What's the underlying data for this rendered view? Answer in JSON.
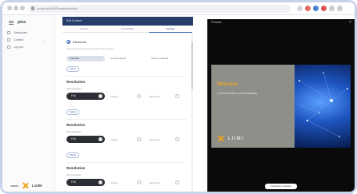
{
  "browser": {
    "url": "localhost:8080/content/editor"
  },
  "sidebar": {
    "brand": "pico",
    "items": [
      {
        "label": "Dashboard"
      },
      {
        "label": "Content"
      },
      {
        "label": "Log out"
      }
    ],
    "footer_word": "LUMI"
  },
  "editor": {
    "header": "Edit Content",
    "tabs": [
      {
        "label": "Content"
      },
      {
        "label": "Accessibility"
      },
      {
        "label": "Settings"
      }
    ],
    "first_option": {
      "label": "Elements",
      "hint": "Choose how elements appear in the content",
      "chips": [
        "Standard",
        "Content layout",
        "Source material"
      ]
    },
    "button_label": "Delete",
    "resolutions": [
      {
        "title": "Resolution",
        "label": "Set resolution",
        "value": "Full",
        "options": [
          "Always",
          "Windowed"
        ]
      },
      {
        "title": "Resolution",
        "label": "Set resolution",
        "value": "Full",
        "options": [
          "Always",
          "Windowed"
        ]
      },
      {
        "title": "Resolution",
        "label": "Set resolution",
        "value": "Full",
        "options": [
          "Always",
          "Windowed"
        ]
      }
    ]
  },
  "preview": {
    "title": "Preview",
    "close": "×",
    "slide": {
      "heading": "Welcome",
      "subheading": "Lumi interactive content framing",
      "logo_word": "LUMI"
    },
    "button_label": "Fullscreen preview"
  },
  "colors": {
    "header": "#263c69",
    "accent": "#3a62b8",
    "preview_bg": "#0a0a0b",
    "slide_panel": "#8f8f8a",
    "slide_accent": "#e4a328"
  }
}
